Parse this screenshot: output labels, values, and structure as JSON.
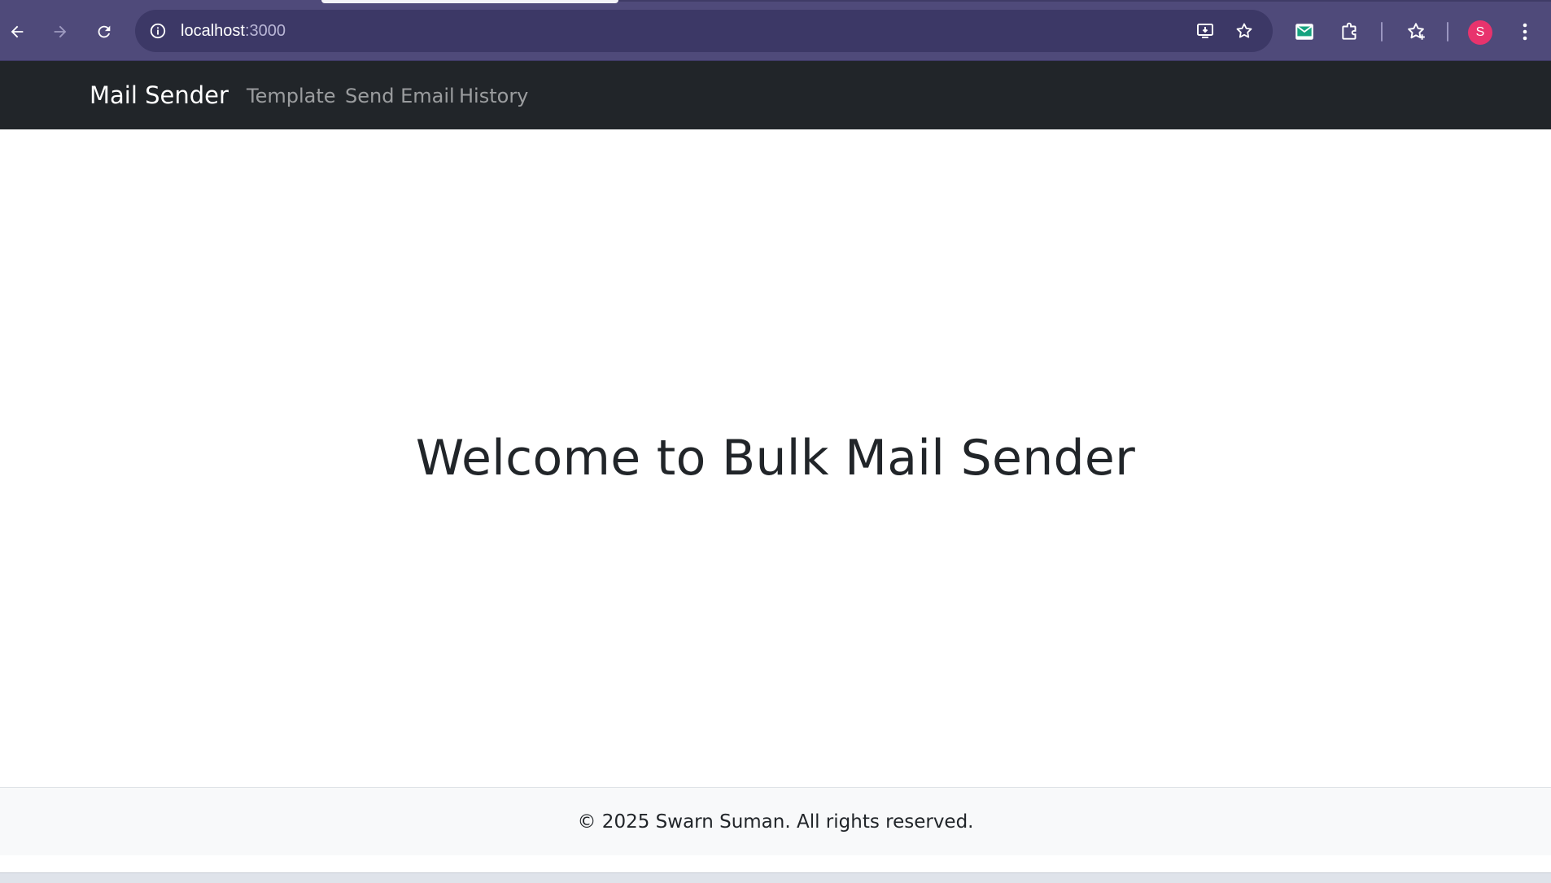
{
  "browser": {
    "url_host": "localhost",
    "url_port": ":3000",
    "profile_initial": "S"
  },
  "icons": {
    "back": "arrow-left-icon",
    "forward": "arrow-right-icon",
    "reload": "reload-icon",
    "info": "info-icon",
    "install": "install-app-icon",
    "bookmark": "star-icon",
    "extension_mail": "mail-extension-icon",
    "extensions": "puzzle-icon",
    "bookmarks": "bookmarks-icon",
    "menu": "kebab-menu-icon"
  },
  "navbar": {
    "brand": "Mail Sender",
    "links": [
      "Template",
      "Send Email",
      "History"
    ]
  },
  "main": {
    "heading": "Welcome to Bulk Mail Sender"
  },
  "footer": {
    "text": "© 2025 Swarn Suman. All rights reserved."
  },
  "colors": {
    "browser_chrome": "#4f4a7a",
    "navbar_bg": "#212529",
    "footer_bg": "#f8f9fa",
    "avatar_bg": "#e8336d"
  }
}
